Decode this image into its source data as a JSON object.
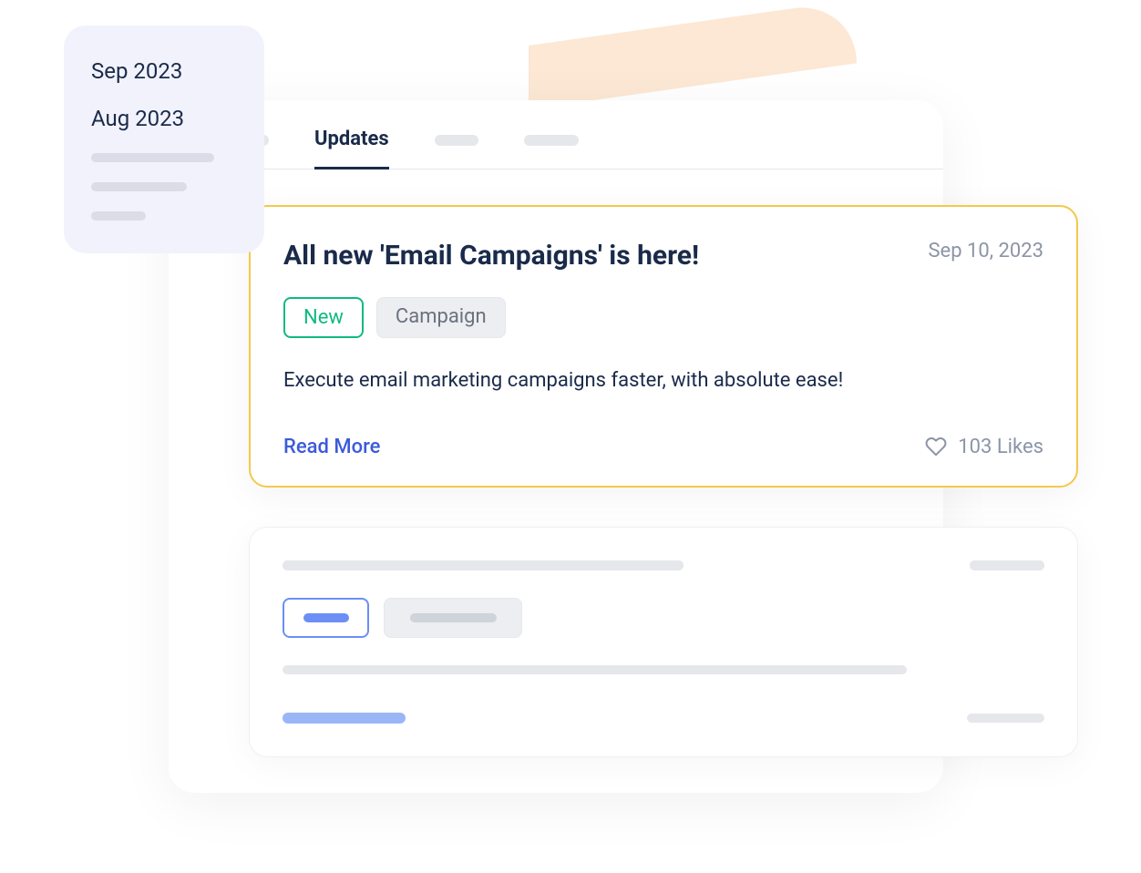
{
  "sidebar": {
    "items": [
      "Sep 2023",
      "Aug 2023"
    ]
  },
  "tabs": {
    "active": "Updates"
  },
  "featured": {
    "title": "All new 'Email Campaigns' is here!",
    "date": "Sep 10, 2023",
    "tags": {
      "new": "New",
      "campaign": "Campaign"
    },
    "description": "Execute email marketing campaigns faster, with absolute ease!",
    "read_more": "Read More",
    "likes": "103 Likes"
  }
}
